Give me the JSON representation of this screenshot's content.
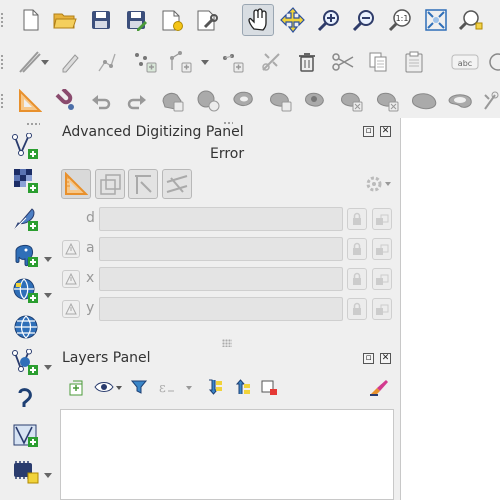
{
  "toolbars": {
    "file": [
      "new-project-icon",
      "open-project-icon",
      "save-project-icon",
      "save-as-icon",
      "new-print-layout-icon",
      "layout-manager-icon"
    ],
    "map_navigation": [
      "pan-icon",
      "pan-to-selection-icon",
      "zoom-in-icon",
      "zoom-out-icon",
      "zoom-native-icon",
      "zoom-full-icon",
      "zoom-to-selection-icon"
    ],
    "digitizing": [
      "digitize-line-icon",
      "toggle-editing-icon",
      "add-feature-icon",
      "vertex-tool-icon",
      "move-feature-icon",
      "delete-selected-icon",
      "cut-features-icon",
      "copy-features-icon",
      "paste-features-icon",
      "label-icon"
    ],
    "advanced_digitizing": [
      "shape-digitize-icon",
      "magnet-icon",
      "undo-icon",
      "redo-icon",
      "rotate-feature-icon",
      "simplify-icon",
      "add-ring-icon",
      "add-part-icon",
      "fill-ring-icon",
      "delete-ring-icon",
      "delete-part-icon",
      "reshape-icon",
      "offset-curve-icon",
      "split-features-icon"
    ],
    "native_zoom_text": "1:1",
    "label_text": "abc"
  },
  "left_toolbar": {
    "items": [
      "add-vector-layer-icon",
      "add-raster-layer-icon",
      "add-delimited-text-icon",
      "add-postgis-icon",
      "add-wms-icon",
      "add-wcs-icon",
      "add-wfs-icon",
      "add-virtual-layer-icon",
      "add-spatialite-icon",
      "add-mesh-layer-icon"
    ]
  },
  "advanced_digitizing_panel": {
    "title": "Advanced Digitizing Panel",
    "status": "Error",
    "fields": [
      {
        "label": "d",
        "value": ""
      },
      {
        "label": "a",
        "value": ""
      },
      {
        "label": "x",
        "value": ""
      },
      {
        "label": "y",
        "value": ""
      }
    ]
  },
  "layers_panel": {
    "title": "Layers Panel",
    "tools": [
      "open-layer-styling-icon",
      "manage-visibility-icon",
      "filter-legend-icon",
      "filter-expression-icon",
      "expand-all-icon",
      "collapse-all-icon",
      "remove-layer-icon",
      "edit-style-icon"
    ]
  },
  "colors": {
    "accent_orange": "#e8902c",
    "green_plus": "#2b9e30",
    "blue": "#2f6fb8",
    "navy": "#2a3c6e"
  }
}
